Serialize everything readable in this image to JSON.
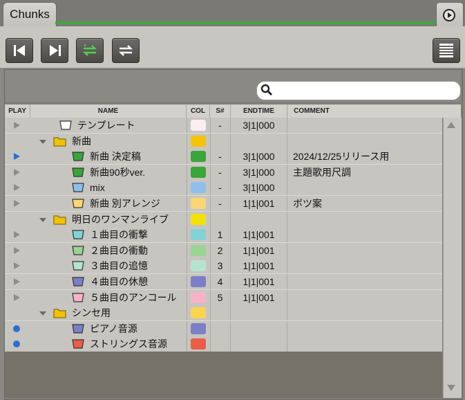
{
  "tab": {
    "label": "Chunks"
  },
  "toolbar": {
    "buttons": [
      "skip-to-start",
      "skip-to-end",
      "convert-green",
      "convert-white",
      "list-view"
    ]
  },
  "search": {
    "placeholder": "",
    "value": ""
  },
  "columns": {
    "play": "PLAY",
    "name": "NAME",
    "col": "COL",
    "snum": "S#",
    "endtime": "ENDTIME",
    "comment": "COMMENT"
  },
  "rows": [
    {
      "play": "triangle",
      "indent": 1,
      "icon": "chunk",
      "icon_color": "#ffffff",
      "name": "テンプレート",
      "color": "#fbeef3",
      "snum": "-",
      "endtime": "3|1|000",
      "comment": ""
    },
    {
      "play": "none",
      "indent": 0,
      "icon": "folder",
      "folder_open": true,
      "icon_color": "#f2c200",
      "name": "新曲",
      "color": "#f5c400",
      "snum": "",
      "endtime": "",
      "comment": ""
    },
    {
      "play": "blue-triangle",
      "indent": 2,
      "icon": "chunk",
      "icon_color": "#3aa53a",
      "name": "新曲 決定稿",
      "color": "#3aa53a",
      "snum": "-",
      "endtime": "3|1|000",
      "comment": "2024/12/25リリース用"
    },
    {
      "play": "triangle",
      "indent": 2,
      "icon": "chunk",
      "icon_color": "#3aa53a",
      "name": "新曲90秒ver.",
      "color": "#3aa53a",
      "snum": "-",
      "endtime": "3|1|000",
      "comment": "主題歌用尺調"
    },
    {
      "play": "triangle",
      "indent": 2,
      "icon": "chunk",
      "icon_color": "#8fc0ec",
      "name": "mix",
      "color": "#8fc0ec",
      "snum": "-",
      "endtime": "3|1|000",
      "comment": ""
    },
    {
      "play": "triangle",
      "indent": 2,
      "icon": "chunk",
      "icon_color": "#fbd774",
      "name": "新曲 別アレンジ",
      "color": "#fbd774",
      "snum": "-",
      "endtime": "1|1|001",
      "comment": "ボツ案"
    },
    {
      "play": "none",
      "indent": 0,
      "icon": "folder",
      "folder_open": true,
      "icon_color": "#f2c200",
      "name": "明日のワンマンライブ",
      "color": "#f3e200",
      "snum": "",
      "endtime": "",
      "comment": ""
    },
    {
      "play": "triangle",
      "indent": 2,
      "icon": "chunk",
      "icon_color": "#7fd3d6",
      "name": "１曲目の衝撃",
      "color": "#7fd3d6",
      "snum": "1",
      "endtime": "1|1|001",
      "comment": ""
    },
    {
      "play": "triangle",
      "indent": 2,
      "icon": "chunk",
      "icon_color": "#9ad492",
      "name": "２曲目の衝動",
      "color": "#9ad492",
      "snum": "2",
      "endtime": "1|1|001",
      "comment": ""
    },
    {
      "play": "triangle",
      "indent": 2,
      "icon": "chunk",
      "icon_color": "#b4e4d0",
      "name": "３曲目の追憶",
      "color": "#b4e4d0",
      "snum": "3",
      "endtime": "1|1|001",
      "comment": ""
    },
    {
      "play": "triangle",
      "indent": 2,
      "icon": "chunk",
      "icon_color": "#7c7fc8",
      "name": "４曲目の休憩",
      "color": "#7c7fc8",
      "snum": "4",
      "endtime": "1|1|001",
      "comment": ""
    },
    {
      "play": "triangle",
      "indent": 2,
      "icon": "chunk",
      "icon_color": "#f7b2ca",
      "name": "５曲目のアンコール",
      "color": "#f7b2ca",
      "snum": "5",
      "endtime": "1|1|001",
      "comment": ""
    },
    {
      "play": "none",
      "indent": 0,
      "icon": "folder",
      "folder_open": true,
      "icon_color": "#f2c200",
      "name": "シンセ用",
      "color": "#fbd450",
      "snum": "",
      "endtime": "",
      "comment": ""
    },
    {
      "play": "dot",
      "indent": 2,
      "icon": "chunk",
      "icon_color": "#7c80c6",
      "name": "ピアノ音源",
      "color": "#7c80c6",
      "snum": "",
      "endtime": "",
      "comment": ""
    },
    {
      "play": "dot",
      "indent": 2,
      "icon": "chunk",
      "icon_color": "#ea5d47",
      "name": "ストリングス音源",
      "color": "#ea5d47",
      "snum": "",
      "endtime": "",
      "comment": ""
    }
  ]
}
